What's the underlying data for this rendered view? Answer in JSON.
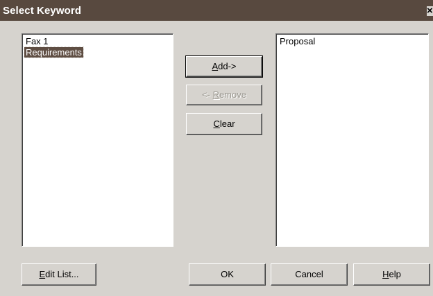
{
  "window": {
    "title": "Select Keyword",
    "close_label": "×"
  },
  "left_list": {
    "items": [
      {
        "label": "Fax 1",
        "selected": false
      },
      {
        "label": "Requirements",
        "selected": true
      }
    ]
  },
  "right_list": {
    "items": [
      {
        "label": "Proposal",
        "selected": false
      }
    ]
  },
  "buttons": {
    "add": {
      "pre": "",
      "mnemonic": "A",
      "post": "dd->",
      "enabled": true
    },
    "remove": {
      "pre": "<- ",
      "mnemonic": "R",
      "post": "emove",
      "enabled": false
    },
    "clear": {
      "pre": "",
      "mnemonic": "C",
      "post": "lear",
      "enabled": true
    },
    "edit_list": {
      "pre": "",
      "mnemonic": "E",
      "post": "dit List...",
      "enabled": true
    },
    "ok": {
      "label": "OK",
      "enabled": true
    },
    "cancel": {
      "label": "Cancel",
      "enabled": true
    },
    "help": {
      "pre": "",
      "mnemonic": "H",
      "post": "elp",
      "enabled": true
    }
  },
  "colors": {
    "titlebar": "#58493f",
    "selection": "#5f4e43",
    "face": "#d6d3ce"
  }
}
